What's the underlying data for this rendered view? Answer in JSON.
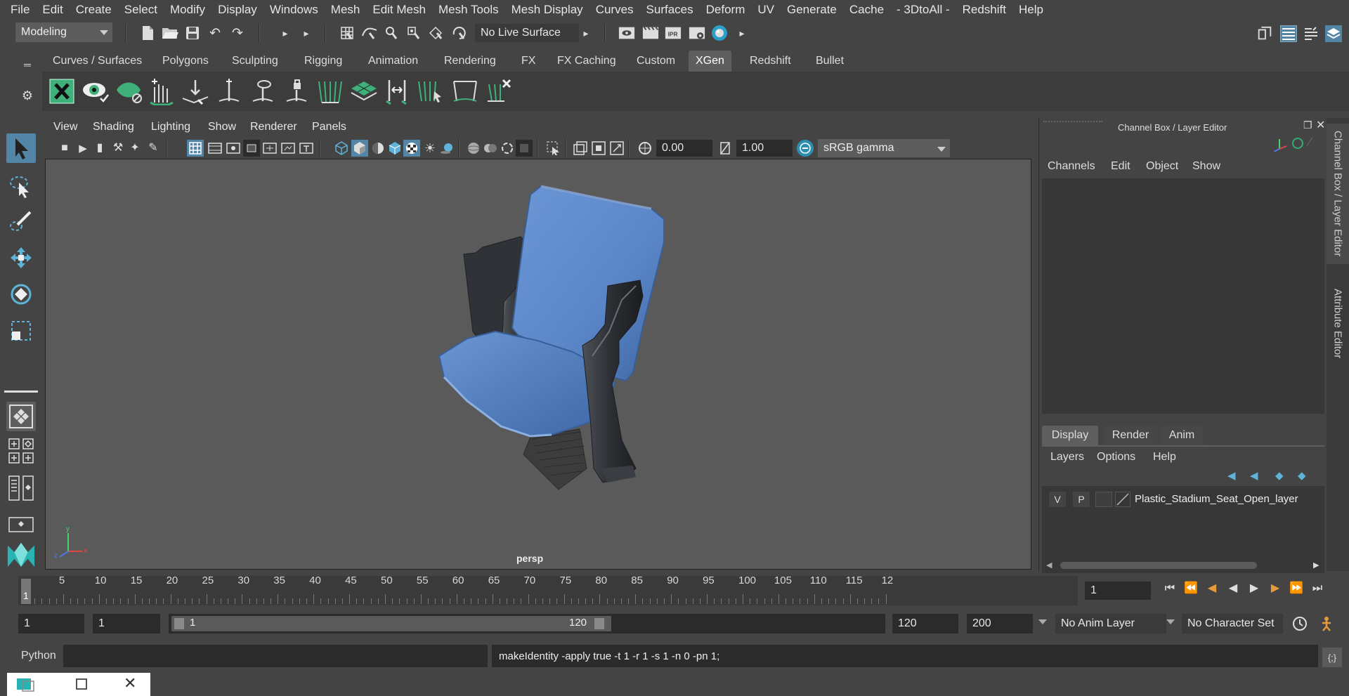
{
  "menubar": [
    "File",
    "Edit",
    "Create",
    "Select",
    "Modify",
    "Display",
    "Windows",
    "Mesh",
    "Edit Mesh",
    "Mesh Tools",
    "Mesh Display",
    "Curves",
    "Surfaces",
    "Deform",
    "UV",
    "Generate",
    "Cache",
    "- 3DtoAll -",
    "Redshift",
    "Help"
  ],
  "statusline": {
    "mode": "Modeling",
    "live_surface": "No Live Surface"
  },
  "shelf_tabs": [
    "Curves / Surfaces",
    "Polygons",
    "Sculpting",
    "Rigging",
    "Animation",
    "Rendering",
    "FX",
    "FX Caching",
    "Custom",
    "XGen",
    "Redshift",
    "Bullet"
  ],
  "shelf_active": "XGen",
  "viewport": {
    "menu": [
      "View",
      "Shading",
      "Lighting",
      "Show",
      "Renderer",
      "Panels"
    ],
    "exposure": "0.00",
    "gamma": "1.00",
    "colorspace": "sRGB gamma",
    "camera_label": "persp",
    "axis": {
      "x": "x",
      "y": "y",
      "z": "z"
    }
  },
  "channel_box": {
    "title": "Channel Box / Layer Editor",
    "menu": [
      "Channels",
      "Edit",
      "Object",
      "Show"
    ]
  },
  "layer_editor": {
    "tabs": [
      "Display",
      "Render",
      "Anim"
    ],
    "active_tab": "Display",
    "menu": [
      "Layers",
      "Options",
      "Help"
    ],
    "layer": {
      "v": "V",
      "p": "P",
      "name": "Plastic_Stadium_Seat_Open_layer"
    }
  },
  "side_tabs": [
    "Channel Box / Layer Editor",
    "Attribute Editor"
  ],
  "timeline": {
    "ticks": [
      "5",
      "10",
      "15",
      "20",
      "25",
      "30",
      "35",
      "40",
      "45",
      "50",
      "55",
      "60",
      "65",
      "70",
      "75",
      "80",
      "85",
      "90",
      "95",
      "100",
      "105",
      "110",
      "115",
      "12"
    ],
    "current_frame_marker": "1",
    "current_frame_field": "1"
  },
  "range": {
    "start": "1",
    "playback_start": "1",
    "slider_start": "1",
    "slider_end": "120",
    "playback_end": "120",
    "end": "200",
    "anim_layer": "No Anim Layer",
    "character_set": "No Character Set"
  },
  "command": {
    "language": "Python",
    "feedback": "makeIdentity -apply true -t 1 -r 1 -s 1 -n 0 -pn 1;"
  },
  "colors": {
    "accent": "#5285a6",
    "seat": "#5a86c8",
    "frame": "#2a2d31",
    "xgen_green": "#3fb07a"
  }
}
